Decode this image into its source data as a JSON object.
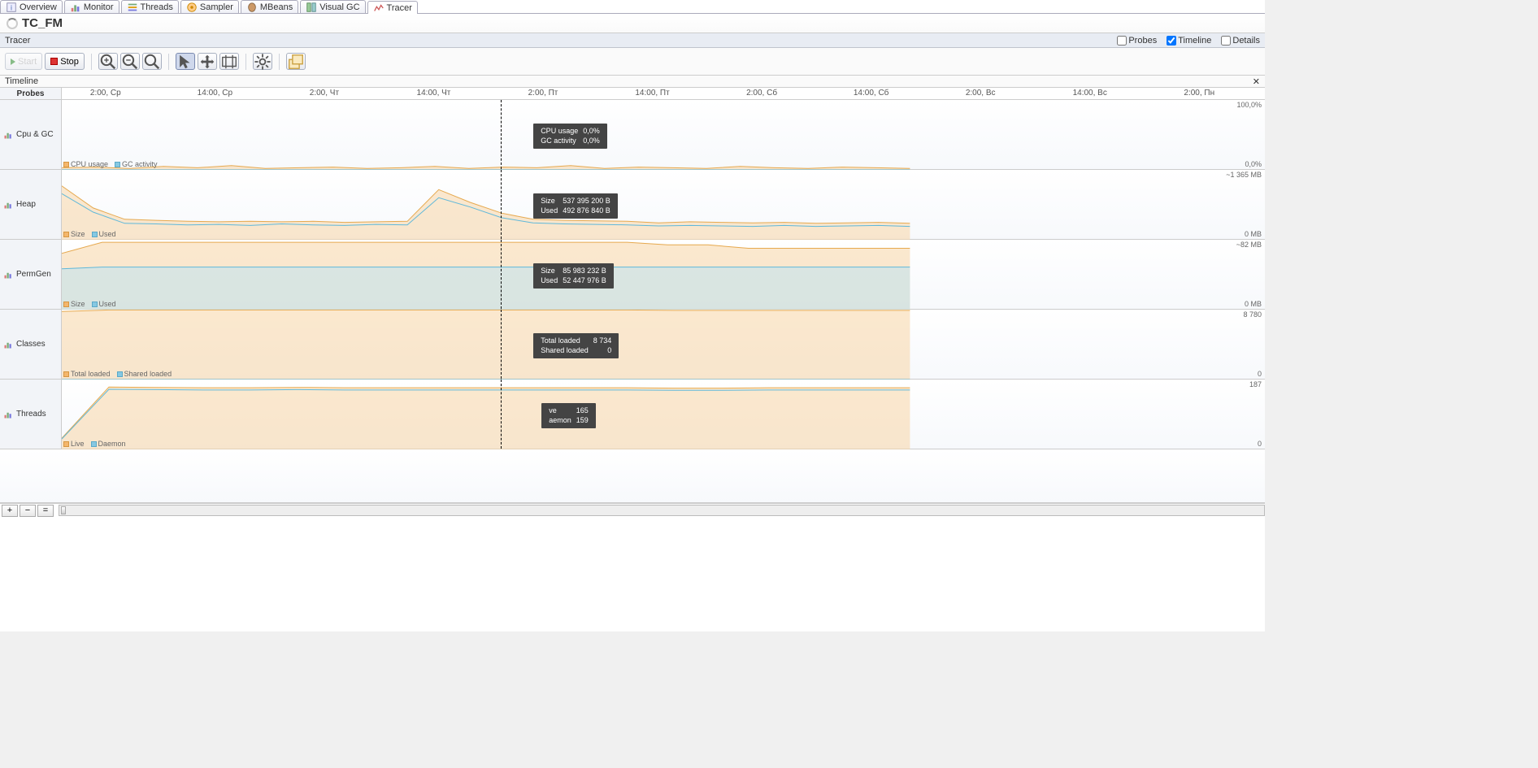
{
  "tabs": [
    {
      "label": "Overview",
      "icon": "info"
    },
    {
      "label": "Monitor",
      "icon": "chart"
    },
    {
      "label": "Threads",
      "icon": "threads"
    },
    {
      "label": "Sampler",
      "icon": "sampler"
    },
    {
      "label": "MBeans",
      "icon": "bean"
    },
    {
      "label": "Visual GC",
      "icon": "gc"
    },
    {
      "label": "Tracer",
      "icon": "tracer",
      "active": true
    }
  ],
  "app_title": "TC_FM",
  "section": {
    "name": "Tracer",
    "checks": [
      {
        "label": "Probes",
        "checked": false
      },
      {
        "label": "Timeline",
        "checked": true
      },
      {
        "label": "Details",
        "checked": false
      }
    ]
  },
  "toolbar": {
    "start": "Start",
    "stop": "Stop"
  },
  "timeline": {
    "header": "Timeline",
    "probes_header": "Probes",
    "ticks": [
      "2:00, Ср",
      "14:00, Ср",
      "2:00, Чт",
      "14:00, Чт",
      "2:00, Пт",
      "14:00, Пт",
      "2:00, Сб",
      "14:00, Сб",
      "2:00, Вс",
      "14:00, Вс",
      "2:00, Пн"
    ],
    "cursor_frac": 0.365
  },
  "tracks": [
    {
      "name": "Cpu & GC",
      "h": 86,
      "ytop": "100,0%",
      "ybot": "0,0%",
      "legend": [
        "CPU usage",
        "GC activity"
      ],
      "tooltip": [
        [
          "CPU usage",
          "0,0%"
        ],
        [
          "GC activity",
          "0,0%"
        ]
      ]
    },
    {
      "name": "Heap",
      "h": 86,
      "ytop": "~1 365 MB",
      "ybot": "0 MB",
      "legend": [
        "Size",
        "Used"
      ],
      "tooltip": [
        [
          "Size",
          "537 395 200 B"
        ],
        [
          "Used",
          "492 876 840 B"
        ]
      ]
    },
    {
      "name": "PermGen",
      "h": 86,
      "ytop": "~82 MB",
      "ybot": "0 MB",
      "legend": [
        "Size",
        "Used"
      ],
      "tooltip": [
        [
          "Size",
          "85 983 232 B"
        ],
        [
          "Used",
          "52 447 976 B"
        ]
      ]
    },
    {
      "name": "Classes",
      "h": 86,
      "ytop": "8 780",
      "ybot": "0",
      "legend": [
        "Total loaded",
        "Shared loaded"
      ],
      "tooltip": [
        [
          "Total loaded",
          "8 734"
        ],
        [
          "Shared loaded",
          "0"
        ]
      ]
    },
    {
      "name": "Threads",
      "h": 86,
      "ytop": "187",
      "ybot": "0",
      "legend": [
        "Live",
        "Daemon"
      ],
      "tooltip": [
        [
          "ve",
          "165"
        ],
        [
          "aemon",
          "159"
        ]
      ]
    }
  ],
  "chart_data": {
    "type": "line",
    "x_axis": {
      "start": "2:00 Ср",
      "end": "2:00 Пн",
      "ticks": [
        "2:00, Ср",
        "14:00, Ср",
        "2:00, Чт",
        "14:00, Чт",
        "2:00, Пт",
        "14:00, Пт",
        "2:00, Сб",
        "14:00, Сб",
        "2:00, Вс",
        "14:00, Вс",
        "2:00, Пн"
      ]
    },
    "data_span_frac": [
      0.0,
      0.705
    ],
    "cursor_frac": 0.365,
    "series": [
      {
        "track": "Cpu & GC",
        "name": "CPU usage",
        "color": "#F4B66C",
        "ylim": [
          0,
          100
        ],
        "unit": "%",
        "samples": [
          3,
          4,
          2,
          5,
          3,
          6,
          2,
          3,
          4,
          2,
          3,
          5,
          2,
          4,
          3,
          6,
          2,
          4,
          3,
          2,
          5,
          3,
          2,
          4,
          3,
          2
        ]
      },
      {
        "track": "Cpu & GC",
        "name": "GC activity",
        "color": "#86C8E2",
        "ylim": [
          0,
          100
        ],
        "unit": "%",
        "samples": [
          0,
          0,
          0,
          0,
          0,
          0,
          0,
          0,
          0,
          0,
          0,
          0,
          0,
          0,
          0,
          0,
          0,
          0,
          0,
          0,
          0,
          0,
          0,
          0,
          0,
          0
        ]
      },
      {
        "track": "Heap",
        "name": "Size",
        "color": "#F4B66C",
        "ylim": [
          0,
          1365
        ],
        "unit": "MB",
        "samples": [
          1050,
          620,
          400,
          380,
          360,
          350,
          360,
          350,
          360,
          340,
          350,
          360,
          980,
          730,
          520,
          400,
          380,
          370,
          360,
          330,
          350,
          340,
          330,
          340,
          320,
          330,
          340,
          320
        ]
      },
      {
        "track": "Heap",
        "name": "Used",
        "color": "#86C8E2",
        "ylim": [
          0,
          1365
        ],
        "unit": "MB",
        "samples": [
          900,
          540,
          320,
          310,
          290,
          300,
          280,
          310,
          290,
          280,
          300,
          290,
          820,
          640,
          430,
          330,
          310,
          300,
          290,
          270,
          280,
          270,
          260,
          280,
          260,
          270,
          280,
          260
        ]
      },
      {
        "track": "PermGen",
        "name": "Size",
        "color": "#F4B66C",
        "ylim": [
          0,
          82
        ],
        "unit": "MB",
        "samples": [
          66,
          79,
          79,
          79,
          79,
          79,
          79,
          79,
          79,
          79,
          79,
          79,
          79,
          79,
          79,
          76,
          76,
          72,
          72,
          72,
          72,
          72
        ]
      },
      {
        "track": "PermGen",
        "name": "Used",
        "color": "#86C8E2",
        "ylim": [
          0,
          82
        ],
        "unit": "MB",
        "samples": [
          48,
          50,
          50,
          50,
          50,
          50,
          50,
          50,
          50,
          50,
          50,
          50,
          50,
          50,
          50,
          50,
          50,
          50,
          50,
          50,
          50,
          50
        ]
      },
      {
        "track": "Classes",
        "name": "Total loaded",
        "color": "#F4B66C",
        "ylim": [
          0,
          8780
        ],
        "unit": "",
        "samples": [
          8550,
          8735,
          8735,
          8735,
          8735,
          8735,
          8735,
          8735,
          8735,
          8735,
          8735,
          8735,
          8735,
          8690,
          8690,
          8690,
          8690,
          8690,
          8690
        ]
      },
      {
        "track": "Classes",
        "name": "Shared loaded",
        "color": "#86C8E2",
        "ylim": [
          0,
          8780
        ],
        "unit": "",
        "samples": [
          0,
          0,
          0,
          0,
          0,
          0,
          0,
          0,
          0,
          0,
          0,
          0,
          0,
          0,
          0,
          0,
          0,
          0,
          0
        ]
      },
      {
        "track": "Threads",
        "name": "Live",
        "color": "#F4B66C",
        "ylim": [
          0,
          187
        ],
        "unit": "",
        "samples": [
          30,
          167,
          166,
          165,
          165,
          166,
          165,
          165,
          165,
          165,
          165,
          165,
          165,
          164,
          164,
          165,
          165,
          165,
          165
        ]
      },
      {
        "track": "Threads",
        "name": "Daemon",
        "color": "#86C8E2",
        "ylim": [
          0,
          187
        ],
        "unit": "",
        "samples": [
          28,
          161,
          160,
          159,
          159,
          160,
          159,
          159,
          159,
          159,
          159,
          159,
          159,
          158,
          158,
          159,
          159,
          159,
          159
        ]
      }
    ]
  },
  "bottom": {
    "plus": "+",
    "minus": "−",
    "eq": "="
  }
}
